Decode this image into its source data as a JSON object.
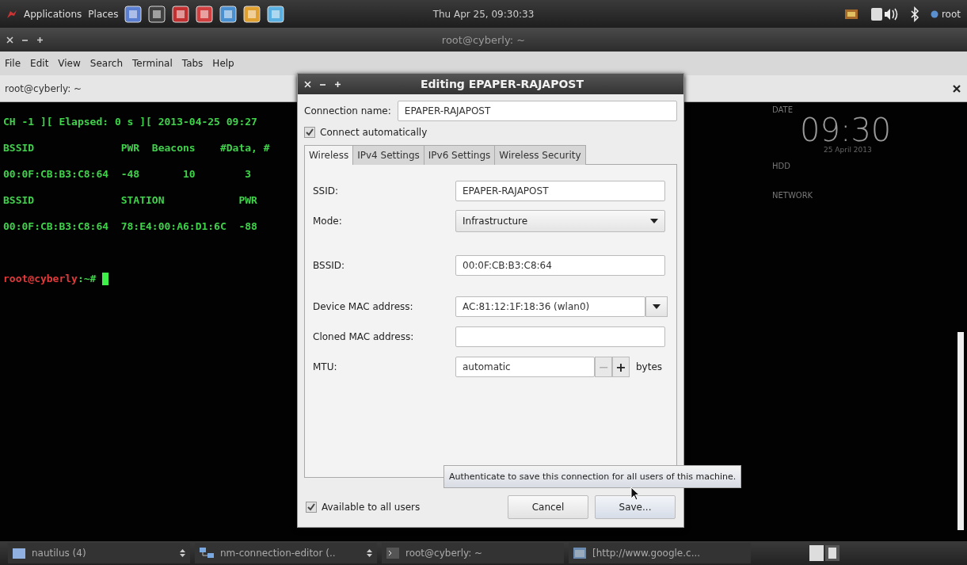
{
  "top_panel": {
    "menus": [
      "Applications",
      "Places"
    ],
    "clock": "Thu Apr 25, 09:30:33",
    "user": "root"
  },
  "terminal_window": {
    "title": "root@cyberly: ~",
    "menu": [
      "File",
      "Edit",
      "View",
      "Search",
      "Terminal",
      "Tabs",
      "Help"
    ],
    "tab": {
      "label": "root@cyberly: ~"
    },
    "lines": [
      "CH -1 ][ Elapsed: 0 s ][ 2013-04-25 09:27",
      "BSSID              PWR  Beacons    #Data, #",
      "00:0F:CB:B3:C8:64  -48       10        3",
      "BSSID              STATION            PWR",
      "00:0F:CB:B3:C8:64  78:E4:00:A6:D1:6C  -88"
    ],
    "prompt": {
      "user_host": "root@cyberly",
      "path": ":~#"
    }
  },
  "desktop_widget": {
    "date_label": "DATE",
    "time": "09:30",
    "date": "25 April 2013",
    "hdd_label": "HDD",
    "network_label": "NETWORK"
  },
  "dialog": {
    "title": "Editing EPAPER-RAJAPOST",
    "connection_name_label": "Connection name:",
    "connection_name": "EPAPER-RAJAPOST",
    "connect_automatically": {
      "label": "Connect automatically",
      "checked": true
    },
    "tabs": [
      {
        "label": "Wireless",
        "selected": true
      },
      {
        "label": "IPv4 Settings",
        "selected": false
      },
      {
        "label": "IPv6 Settings",
        "selected": false
      },
      {
        "label": "Wireless Security",
        "selected": false
      }
    ],
    "fields": [
      {
        "label": "SSID:",
        "kind": "entry",
        "value": "EPAPER-RAJAPOST"
      },
      {
        "label": "Mode:",
        "kind": "combo",
        "value": "Infrastructure"
      },
      {
        "label": "BSSID:",
        "kind": "entry",
        "value": "00:0F:CB:B3:C8:64"
      },
      {
        "label": "Device MAC address:",
        "kind": "combo_entry",
        "value": "AC:81:12:1F:18:36 (wlan0)"
      },
      {
        "label": "Cloned MAC address:",
        "kind": "entry"
      },
      {
        "label": "MTU:",
        "kind": "spin",
        "value": "automatic",
        "unit": "bytes",
        "minus": "−",
        "plus": "+"
      }
    ],
    "available_to_all": {
      "label": "Available to all users",
      "checked": true
    },
    "buttons": [
      {
        "label": "Cancel",
        "hovered": false
      },
      {
        "label": "Save...",
        "hovered": true
      }
    ],
    "tooltip": "Authenticate to save this connection for all users of this machine."
  },
  "taskbar": {
    "items": [
      {
        "label": "nautilus (4)",
        "kind": "folder",
        "grouped": true
      },
      {
        "label": "nm-connection-editor (..",
        "kind": "network",
        "grouped": true
      },
      {
        "label": "root@cyberly: ~",
        "kind": "terminal",
        "grouped": false
      },
      {
        "label": "[http://www.google.c...",
        "kind": "browser",
        "grouped": false
      }
    ]
  }
}
